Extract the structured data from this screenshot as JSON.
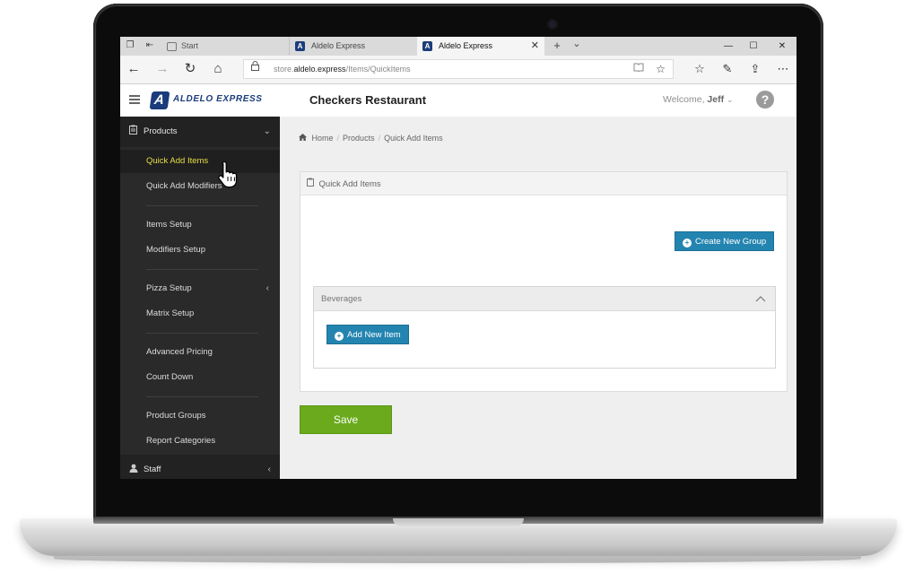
{
  "browser": {
    "tabs": [
      {
        "label": "Start"
      },
      {
        "label": "Aldelo Express"
      },
      {
        "label": "Aldelo Express"
      }
    ],
    "url_prefix": "store.",
    "url_domain": "aldelo.express",
    "url_path": "/Items/QuickItems",
    "icons": {
      "back": "←",
      "forward": "→",
      "refresh": "↻",
      "home": "⌂",
      "lock": "🔒",
      "reading": "📖",
      "favorite": "☆",
      "hub": "☆",
      "notes": "✎",
      "share": "⇪",
      "more": "⋯",
      "close": "✕",
      "newtab": "+",
      "tablist": "⌄",
      "minimize": "—",
      "maximize": "☐",
      "winclose": "✕"
    }
  },
  "header": {
    "brand": "ALDELO EXPRESS",
    "restaurant": "Checkers Restaurant",
    "welcome_prefix": "Welcome,",
    "user": "Jeff",
    "help": "?"
  },
  "sidebar": {
    "sections": [
      {
        "label": "Products"
      },
      {
        "label": "Staff"
      }
    ],
    "items": [
      {
        "label": "Quick Add Items"
      },
      {
        "label": "Quick Add Modifiers"
      },
      {
        "label": "Items Setup"
      },
      {
        "label": "Modifiers Setup"
      },
      {
        "label": "Pizza Setup"
      },
      {
        "label": "Matrix Setup"
      },
      {
        "label": "Advanced Pricing"
      },
      {
        "label": "Count Down"
      },
      {
        "label": "Product Groups"
      },
      {
        "label": "Report Categories"
      }
    ]
  },
  "breadcrumb": [
    "Home",
    "Products",
    "Quick Add Items"
  ],
  "panel": {
    "title": "Quick Add Items",
    "create_group_label": "Create New Group",
    "group": {
      "title": "Beverages",
      "add_item_label": "Add New Item"
    }
  },
  "save_label": "Save",
  "colors": {
    "accent_blue": "#2384b0",
    "save_green": "#6aaa1c",
    "active_item": "#e8df47",
    "sidebar_bg": "#2a2a2a"
  }
}
